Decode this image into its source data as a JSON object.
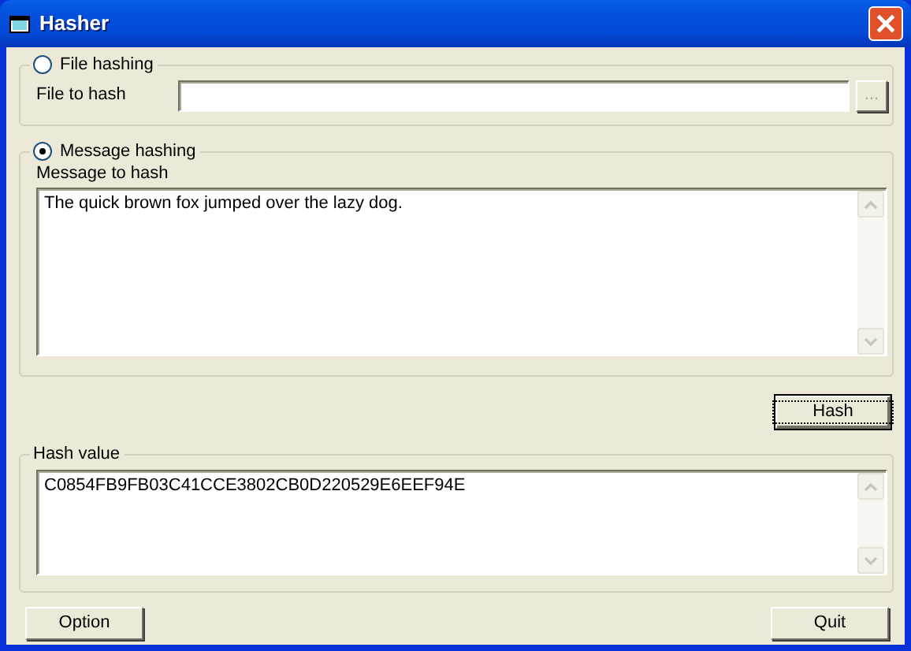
{
  "window": {
    "title": "Hasher"
  },
  "file_group": {
    "label": "File hashing",
    "selected": false,
    "field_label": "File to hash",
    "browse_button": {
      "label": "...",
      "disabled": true
    }
  },
  "message_group": {
    "label": "Message hashing",
    "selected": true,
    "field_label": "Message to hash",
    "message": "The quick brown fox jumped over the lazy dog."
  },
  "hash_button": {
    "label": "Hash",
    "focused": true
  },
  "hash_group": {
    "label": "Hash value",
    "value": "C0854FB9FB03C41CCE3802CB0D220529E6EEF94E"
  },
  "bottom_buttons": [
    {
      "label": "Option",
      "focused": false
    },
    {
      "label": "Quit",
      "focused": false
    }
  ]
}
